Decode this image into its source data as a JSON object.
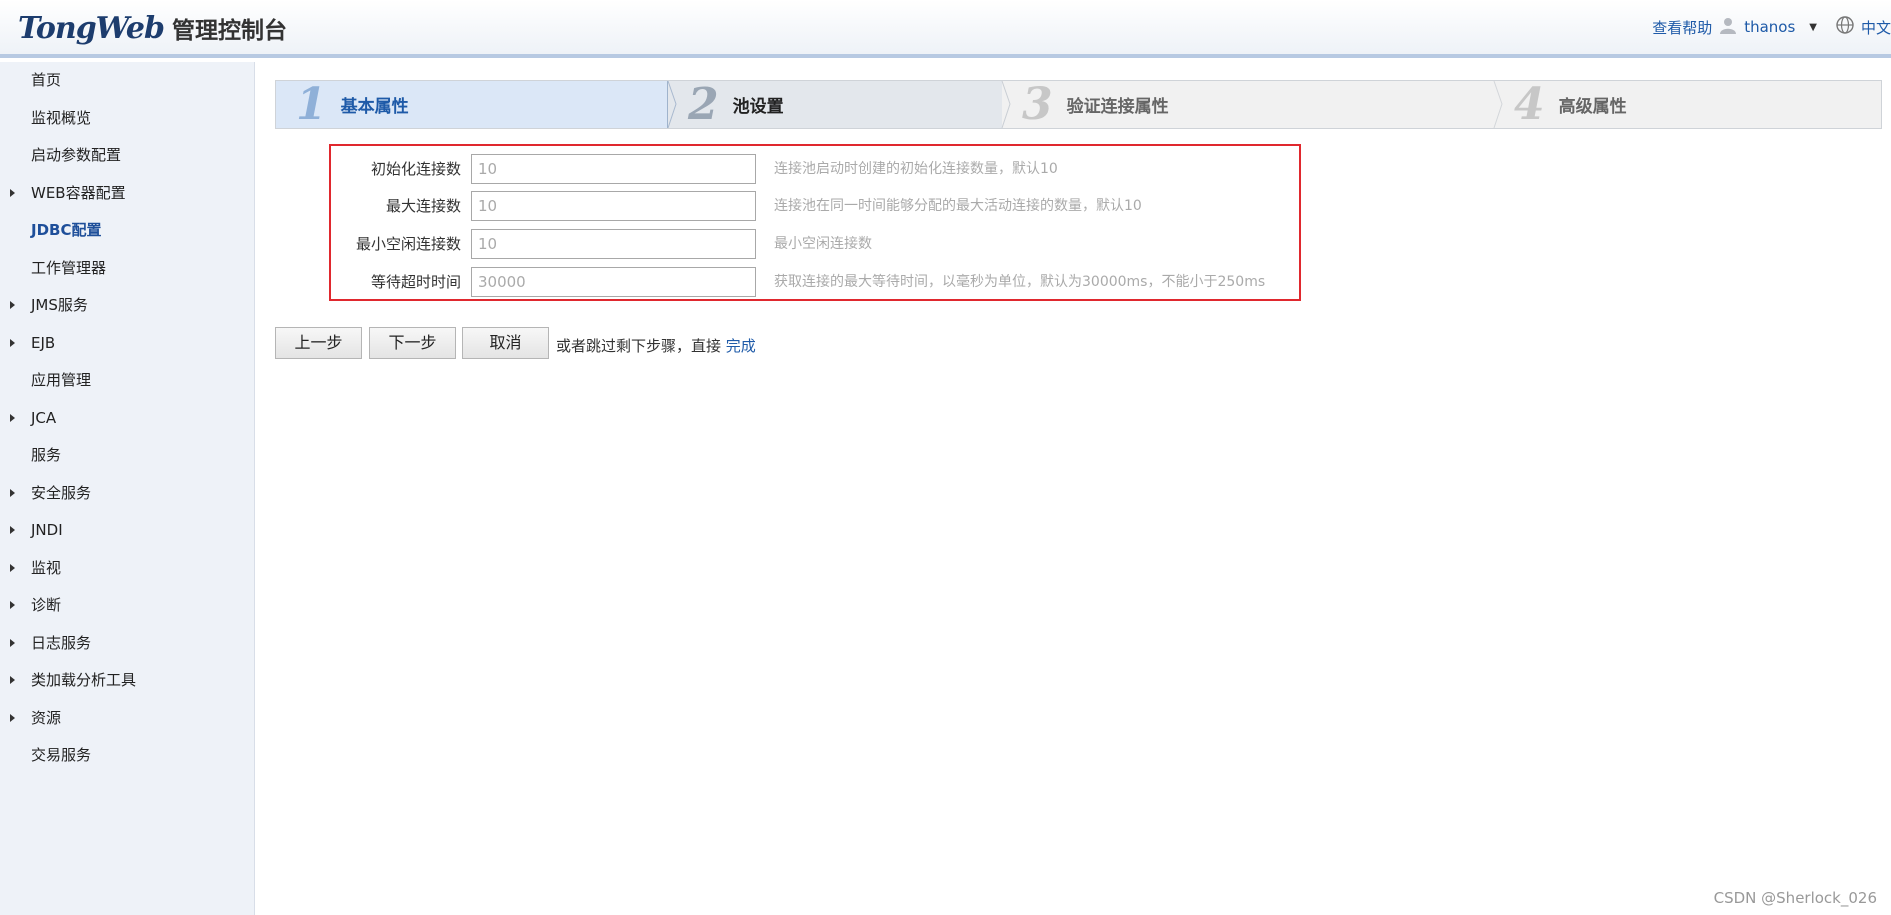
{
  "header": {
    "logo_brand": "TongWeb",
    "logo_suffix": "管理控制台",
    "help_link": "查看帮助",
    "user_name": "thanos",
    "language": "中文"
  },
  "sidebar": {
    "items": [
      {
        "label": "首页",
        "expandable": false
      },
      {
        "label": "监视概览",
        "expandable": false
      },
      {
        "label": "启动参数配置",
        "expandable": false
      },
      {
        "label": "WEB容器配置",
        "expandable": true
      },
      {
        "label": "JDBC配置",
        "expandable": false,
        "active": true
      },
      {
        "label": "工作管理器",
        "expandable": false
      },
      {
        "label": "JMS服务",
        "expandable": true
      },
      {
        "label": "EJB",
        "expandable": true
      },
      {
        "label": "应用管理",
        "expandable": false
      },
      {
        "label": "JCA",
        "expandable": true
      },
      {
        "label": "服务",
        "expandable": false
      },
      {
        "label": "安全服务",
        "expandable": true
      },
      {
        "label": "JNDI",
        "expandable": true
      },
      {
        "label": "监视",
        "expandable": true
      },
      {
        "label": "诊断",
        "expandable": true
      },
      {
        "label": "日志服务",
        "expandable": true
      },
      {
        "label": "类加载分析工具",
        "expandable": true
      },
      {
        "label": "资源",
        "expandable": true
      },
      {
        "label": "交易服务",
        "expandable": false
      }
    ]
  },
  "steps": [
    {
      "num": "1",
      "label": "基本属性"
    },
    {
      "num": "2",
      "label": "池设置"
    },
    {
      "num": "3",
      "label": "验证连接属性"
    },
    {
      "num": "4",
      "label": "高级属性"
    }
  ],
  "form": {
    "rows": [
      {
        "label": "初始化连接数",
        "value": "10",
        "hint": "连接池启动时创建的初始化连接数量，默认10"
      },
      {
        "label": "最大连接数",
        "value": "10",
        "hint": "连接池在同一时间能够分配的最大活动连接的数量，默认10"
      },
      {
        "label": "最小空闲连接数",
        "value": "10",
        "hint": "最小空闲连接数"
      },
      {
        "label": "等待超时时间",
        "value": "30000",
        "hint": "获取连接的最大等待时间，以毫秒为单位，默认为30000ms，不能小于250ms"
      }
    ]
  },
  "actions": {
    "prev": "上一步",
    "next": "下一步",
    "cancel": "取消",
    "skip_text": "或者跳过剩下步骤，直接",
    "finish": "完成"
  },
  "watermark": "CSDN @Sherlock_026",
  "colors": {
    "accent": "#1e5aa8",
    "highlight_border": "#e0282e"
  }
}
